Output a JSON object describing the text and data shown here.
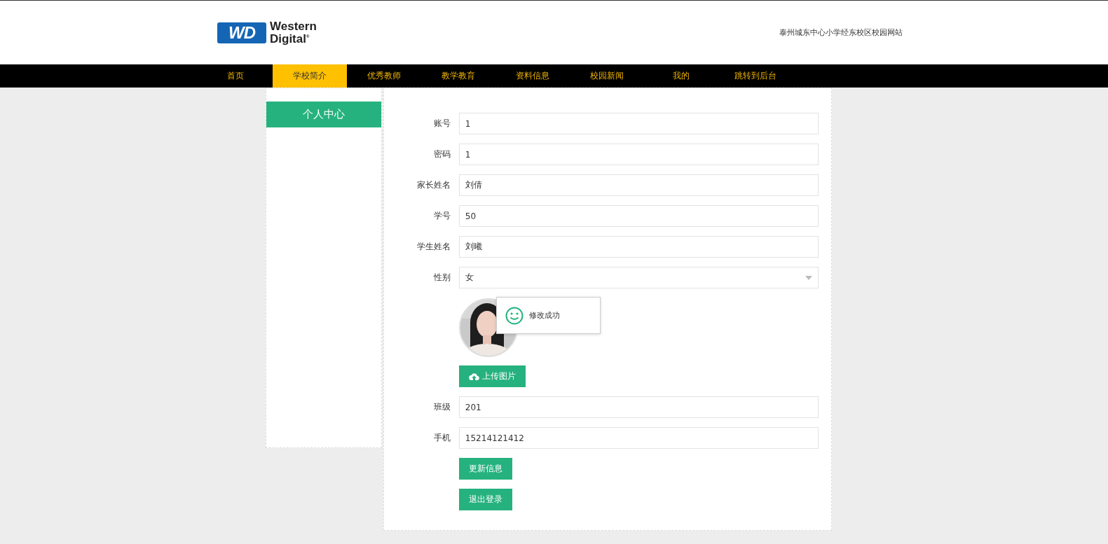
{
  "header": {
    "logo": {
      "mark": "WD",
      "line1": "Western",
      "line2": "Digital$^{®}$"
    },
    "site_title": "泰州城东中心小学经东校区校园网站"
  },
  "nav": [
    {
      "label": "首页",
      "selected": false
    },
    {
      "label": "学校简介",
      "selected": true
    },
    {
      "label": "优秀教师",
      "selected": false
    },
    {
      "label": "教学教育",
      "selected": false
    },
    {
      "label": "资料信息",
      "selected": false
    },
    {
      "label": "校园新闻",
      "selected": false
    },
    {
      "label": "我的",
      "selected": false
    },
    {
      "label": "跳转到后台",
      "selected": false
    }
  ],
  "sidebar": {
    "title": "个人中心"
  },
  "form": {
    "rows": [
      {
        "kind": "text",
        "label": "账号",
        "value": "1"
      },
      {
        "kind": "text",
        "label": "密码",
        "value": "1"
      },
      {
        "kind": "text",
        "label": "家长姓名",
        "value": "刘倩"
      },
      {
        "kind": "text",
        "label": "学号",
        "value": "50"
      },
      {
        "kind": "text",
        "label": "学生姓名",
        "value": "刘曦"
      },
      {
        "kind": "select",
        "label": "性别",
        "value": "女"
      },
      {
        "kind": "avatar"
      },
      {
        "kind": "upload",
        "label": "上传图片"
      },
      {
        "kind": "text",
        "label": "班级",
        "value": "201"
      },
      {
        "kind": "text",
        "label": "手机",
        "value": "15214121412"
      }
    ],
    "buttons": [
      "更新信息",
      "退出登录"
    ]
  },
  "toast": {
    "message": "修改成功"
  }
}
